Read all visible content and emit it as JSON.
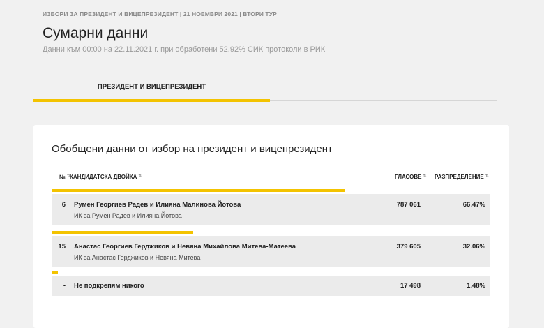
{
  "header": {
    "election_line": "ИЗБОРИ ЗА ПРЕЗИДЕНТ И ВИЦЕПРЕЗИДЕНТ | 21 НОЕМВРИ 2021 | ВТОРИ ТУР",
    "title": "Сумарни данни",
    "subtitle": "Данни към 00:00 на 22.11.2021 г. при обработени 52.92% СИК протоколи в РИК"
  },
  "tabs": [
    {
      "label": "ПРЕЗИДЕНТ И ВИЦЕПРЕЗИДЕНТ",
      "active": true
    }
  ],
  "accent_color": "#f3c300",
  "table": {
    "title": "Обобщени данни от избор на президент и вицепрезидент",
    "columns": {
      "number": "№",
      "candidates": "КАНДИДАТСКА ДВОЙКА",
      "votes": "ГЛАСОВЕ",
      "share": "РАЗПРЕДЕЛЕНИЕ"
    },
    "sort_icon": "⇅",
    "rows": [
      {
        "number": "6",
        "candidates": "Румен Георгиев Радев и Илияна Малинова Йотова",
        "committee": "ИК за Румен Радев и Илияна Йотова",
        "votes": "787 061",
        "share": "66.47%",
        "share_value": 66.47
      },
      {
        "number": "15",
        "candidates": "Анастас Георгиев Герджиков и Невяна Михайлова Митева-Матеева",
        "committee": "ИК за Анастас Герджиков и Невяна Митева",
        "votes": "379 605",
        "share": "32.06%",
        "share_value": 32.06
      },
      {
        "number": "-",
        "candidates": "Не подкрепям никого",
        "committee": "",
        "votes": "17 498",
        "share": "1.48%",
        "share_value": 1.48
      }
    ]
  }
}
